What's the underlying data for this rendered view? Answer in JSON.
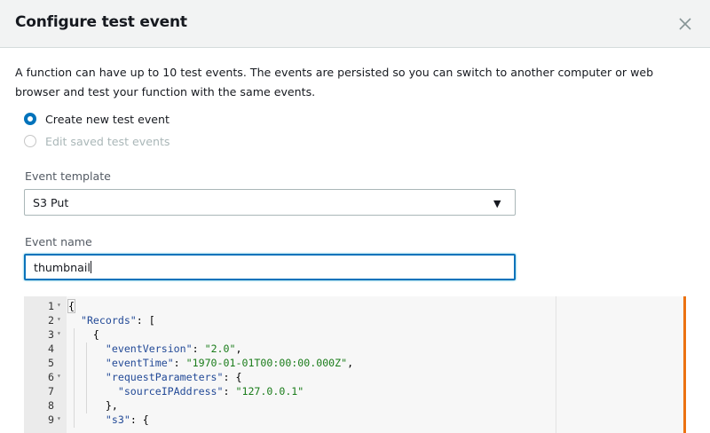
{
  "dialog": {
    "title": "Configure test event",
    "description": "A function can have up to 10 test events. The events are persisted so you can switch to another computer or web browser and test your function with the same events."
  },
  "options": {
    "create_new": "Create new test event",
    "edit_saved": "Edit saved test events"
  },
  "template": {
    "label": "Event template",
    "value": "S3 Put",
    "caret": "▼"
  },
  "event_name": {
    "label": "Event name",
    "value": "thumbnail"
  },
  "editor": {
    "lines": [
      {
        "n": "1",
        "fold": "▾",
        "indent": "",
        "key": "",
        "value": "",
        "punct": "{"
      },
      {
        "n": "2",
        "fold": "▾",
        "indent": "  ",
        "key": "\"Records\"",
        "value": "",
        "punct": ": ["
      },
      {
        "n": "3",
        "fold": "▾",
        "indent": "    ",
        "key": "",
        "value": "",
        "punct": "{"
      },
      {
        "n": "4",
        "fold": "",
        "indent": "      ",
        "key": "\"eventVersion\"",
        "value": "\"2.0\"",
        "punct": ","
      },
      {
        "n": "5",
        "fold": "",
        "indent": "      ",
        "key": "\"eventTime\"",
        "value": "\"1970-01-01T00:00:00.000Z\"",
        "punct": ","
      },
      {
        "n": "6",
        "fold": "▾",
        "indent": "      ",
        "key": "\"requestParameters\"",
        "value": "",
        "punct": ": {"
      },
      {
        "n": "7",
        "fold": "",
        "indent": "        ",
        "key": "\"sourceIPAddress\"",
        "value": "\"127.0.0.1\"",
        "punct": ""
      },
      {
        "n": "8",
        "fold": "",
        "indent": "      ",
        "key": "",
        "value": "",
        "punct": "},"
      },
      {
        "n": "9",
        "fold": "▾",
        "indent": "      ",
        "key": "\"s3\"",
        "value": "",
        "punct": ": {"
      }
    ]
  },
  "colors": {
    "accent": "#0073bb",
    "modified_bar": "#ec7211"
  },
  "icons": {
    "close": "close-icon",
    "fold": "fold-arrow-icon"
  }
}
